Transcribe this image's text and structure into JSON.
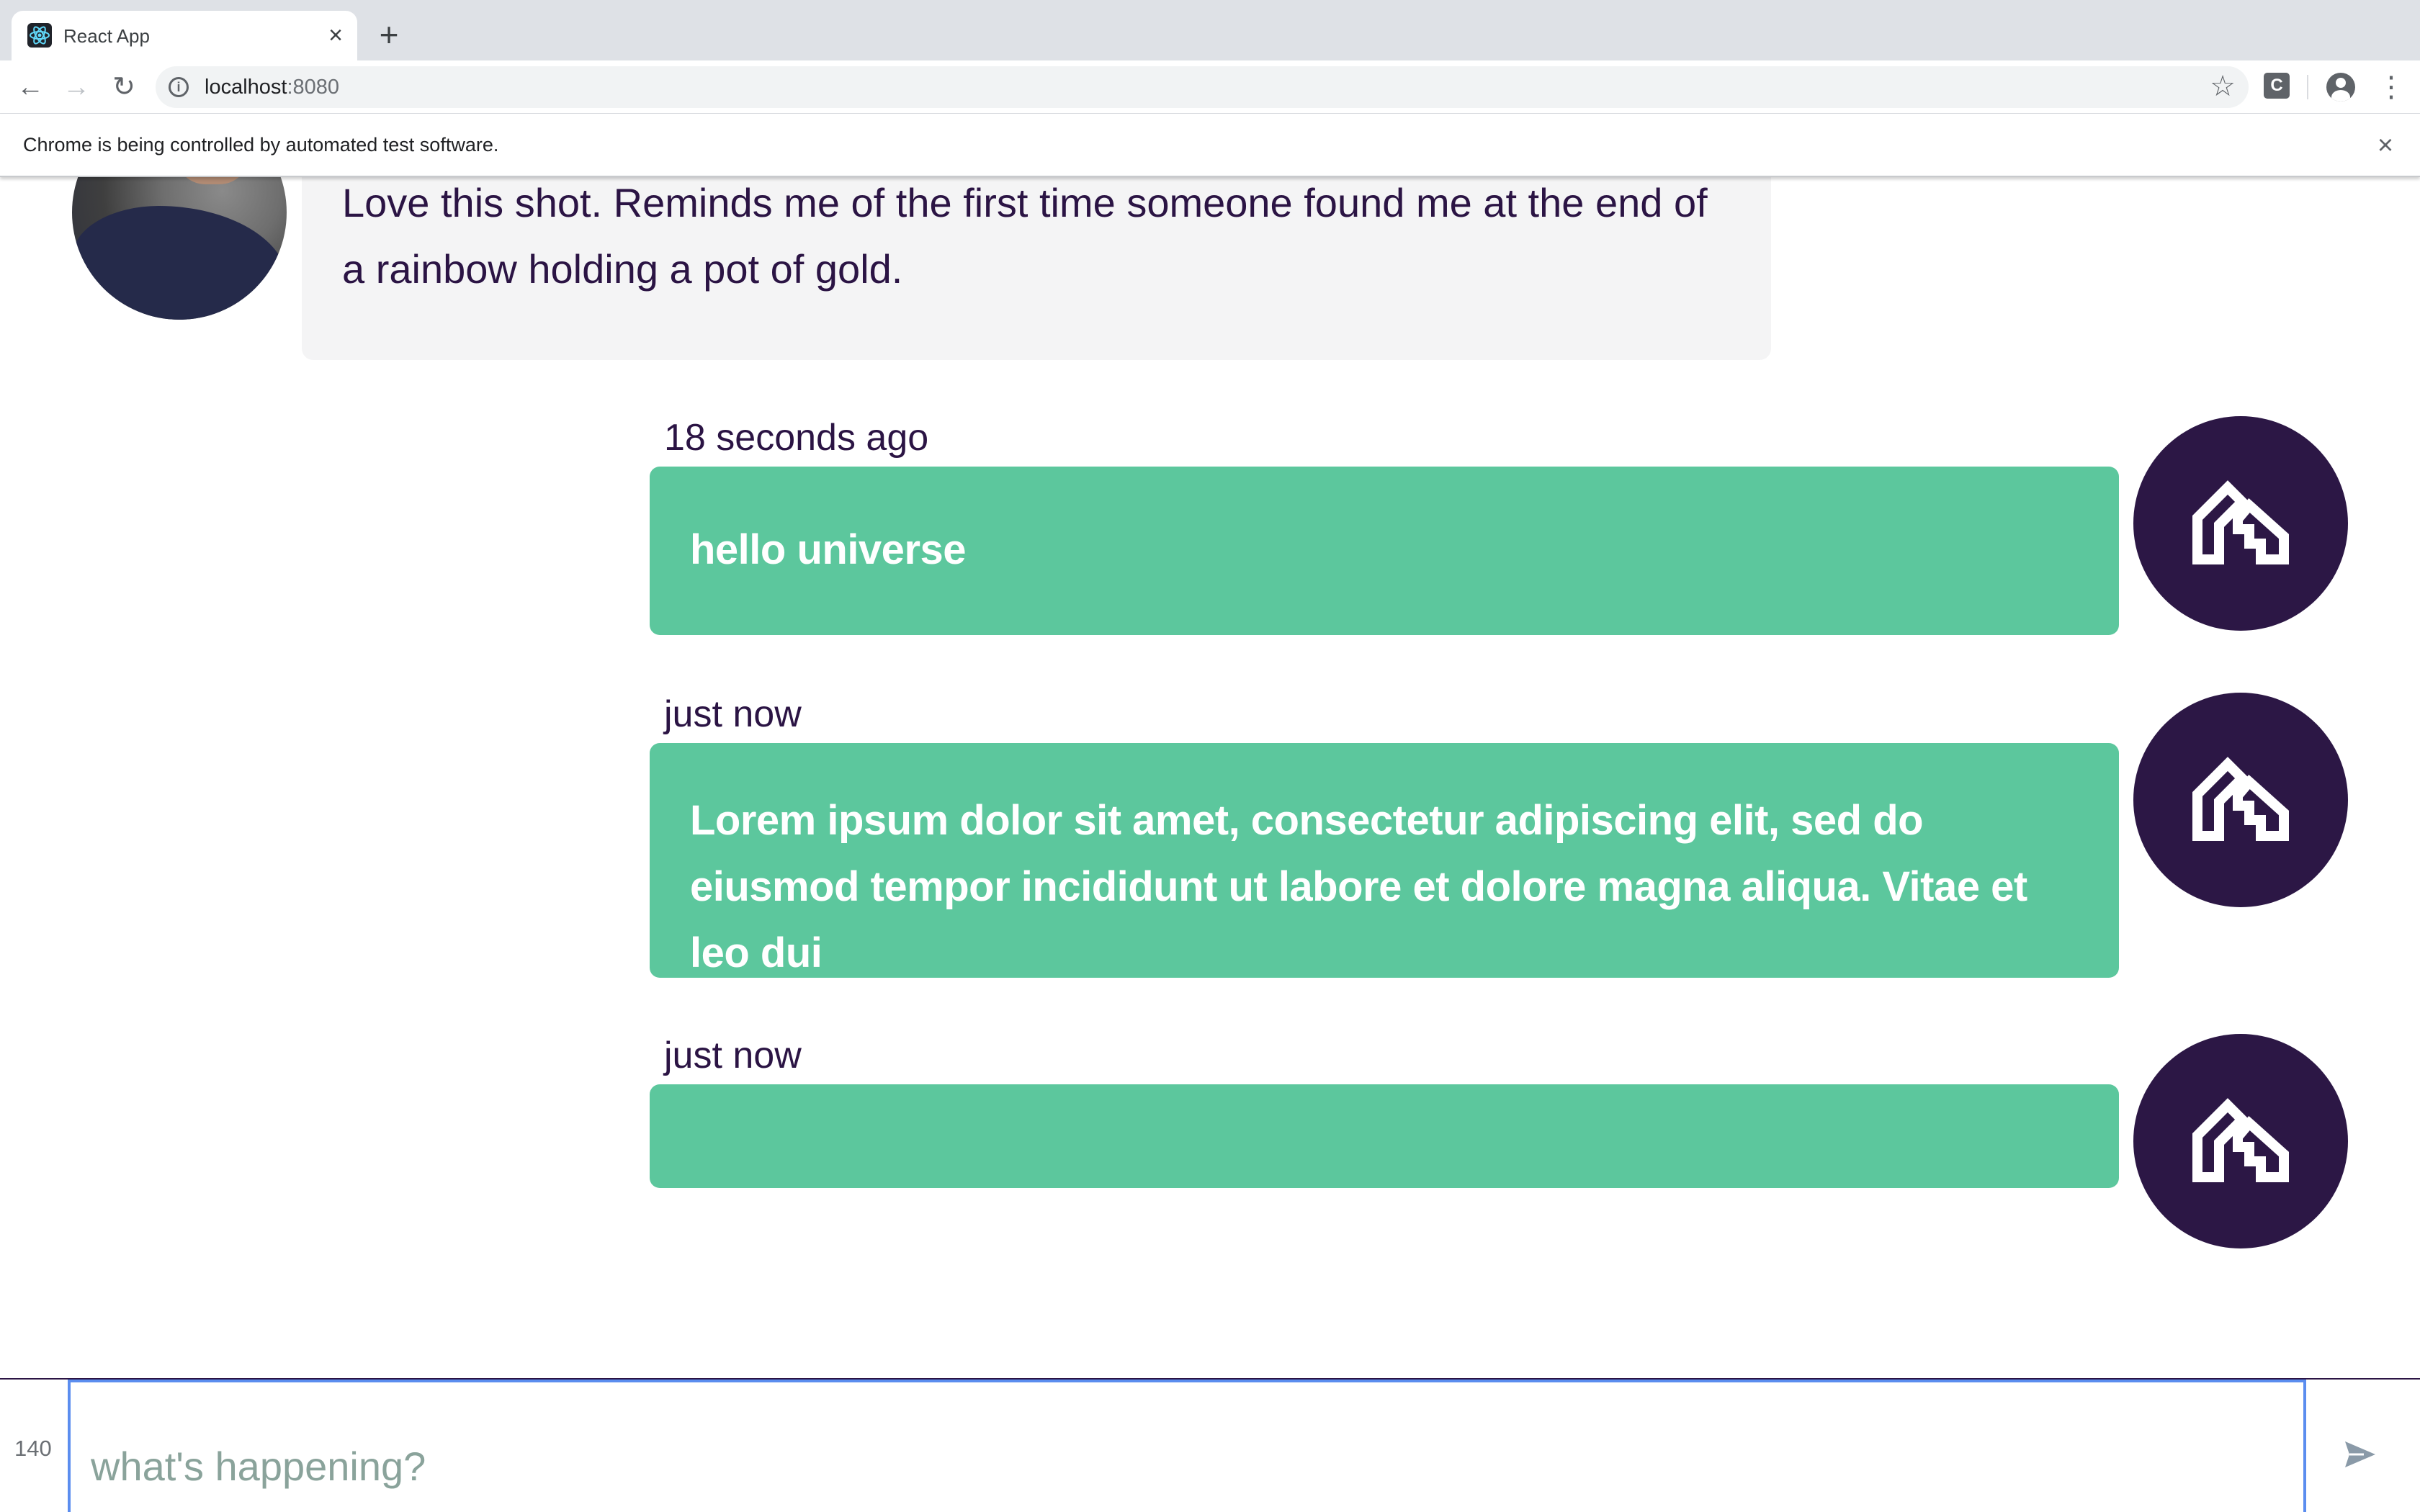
{
  "browser": {
    "tab_title": "React App",
    "tab_close": "×",
    "new_tab": "+",
    "url_host": "localhost",
    "url_port": ":8080",
    "extension_label": "C",
    "infobar_text": "Chrome is being controlled by automated test software.",
    "infobar_close": "×"
  },
  "feed": {
    "received_message": {
      "text": "Love this shot. Reminds me of the first time someone found me at the end of a rainbow holding a pot of gold."
    },
    "sent_messages": [
      {
        "time": "18 seconds ago",
        "text": "hello universe"
      },
      {
        "time": "just now",
        "text": "Lorem ipsum dolor sit amet, consectetur adipiscing elit, sed do eiusmod tempor incididunt ut labore et dolore magna aliqua. Vitae et leo dui"
      },
      {
        "time": "just now",
        "text": ""
      }
    ]
  },
  "composer": {
    "char_count": "140",
    "placeholder": "what's happening?",
    "value": ""
  },
  "colors": {
    "sent_bubble": "#5cc79d",
    "received_bubble": "#f4f4f5",
    "avatar_bg": "#2c1745",
    "text_dark": "#2b1444",
    "input_focus": "#5b8def"
  },
  "icons": {
    "avatar_logo": "house-logo-icon",
    "send": "send-icon"
  }
}
